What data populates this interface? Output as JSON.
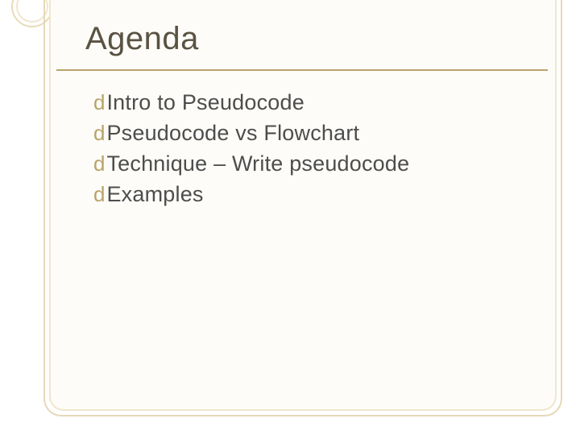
{
  "slide": {
    "title": "Agenda",
    "bullets": [
      {
        "text": "Intro to Pseudocode"
      },
      {
        "text": "Pseudocode vs Flowchart"
      },
      {
        "text": "Technique – Write pseudocode"
      },
      {
        "text": "Examples"
      }
    ],
    "bullet_glyph": "d"
  },
  "theme": {
    "accent": "#b9a36a",
    "frame": "#e6d8b8",
    "title_color": "#5a5242",
    "text_color": "#4d4d4d"
  }
}
